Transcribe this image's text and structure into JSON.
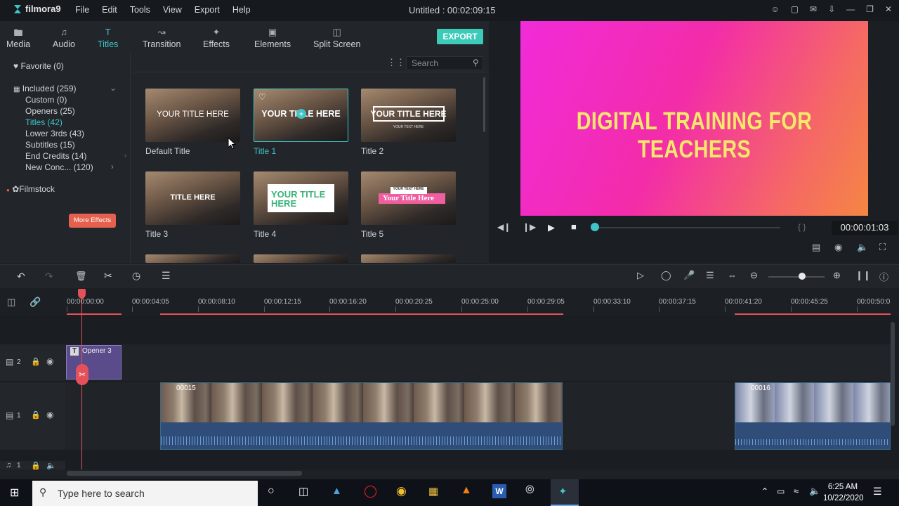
{
  "app": {
    "name": "filmora9",
    "project_title": "Untitled : 00:02:09:15"
  },
  "menu": [
    "File",
    "Edit",
    "Tools",
    "View",
    "Export",
    "Help"
  ],
  "tabs": [
    {
      "label": "Media",
      "icon": "folder-icon"
    },
    {
      "label": "Audio",
      "icon": "music-note-icon"
    },
    {
      "label": "Titles",
      "icon": "title-t-icon"
    },
    {
      "label": "Transition",
      "icon": "transition-icon"
    },
    {
      "label": "Effects",
      "icon": "effects-icon"
    },
    {
      "label": "Elements",
      "icon": "image-icon"
    },
    {
      "label": "Split Screen",
      "icon": "split-screen-icon"
    }
  ],
  "export_label": "EXPORT",
  "categories": {
    "favorite": "Favorite (0)",
    "included": "Included (259)",
    "items": [
      "Custom (0)",
      "Openers (25)",
      "Titles (42)",
      "Lower 3rds (43)",
      "Subtitles (15)",
      "End Credits (14)",
      "New Conc... (120)"
    ],
    "filmstock": "Filmstock",
    "more_effects": "More Effects"
  },
  "search_placeholder": "Search",
  "titles": [
    {
      "label": "Default Title",
      "text": "YOUR TITLE HERE"
    },
    {
      "label": "Title 1",
      "text": "YOUR TITLE HERE"
    },
    {
      "label": "Title 2",
      "text": "YOUR TITLE HERE",
      "subtext": "YOUR TEXT HERE"
    },
    {
      "label": "Title 3",
      "text": "TITLE HERE"
    },
    {
      "label": "Title 4",
      "text": "YOUR TITLE HERE"
    },
    {
      "label": "Title 5",
      "text": "Your Title Here",
      "subtext": "YOUR TEXT HERE"
    }
  ],
  "preview": {
    "title_text": "DIGITAL TRAINING FOR TEACHERS",
    "timecode": "00:00:01:03",
    "brackets": "{ }"
  },
  "ruler_ticks": [
    "00:00:00:00",
    "00:00:04:05",
    "00:00:08:10",
    "00:00:12:15",
    "00:00:16:20",
    "00:00:20:25",
    "00:00:25:00",
    "00:00:29:05",
    "00:00:33:10",
    "00:00:37:15",
    "00:00:41:20",
    "00:00:45:25",
    "00:00:50:0"
  ],
  "tracks": {
    "track2_label": "2",
    "track1_label": "1",
    "audio_label": "1",
    "title_clip": "Opener 3",
    "clip1": "00015",
    "clip2": "00016",
    "title_clip_icon": "T"
  },
  "taskbar": {
    "search_placeholder": "Type here to search",
    "time": "6:25 AM",
    "date": "10/22/2020"
  }
}
